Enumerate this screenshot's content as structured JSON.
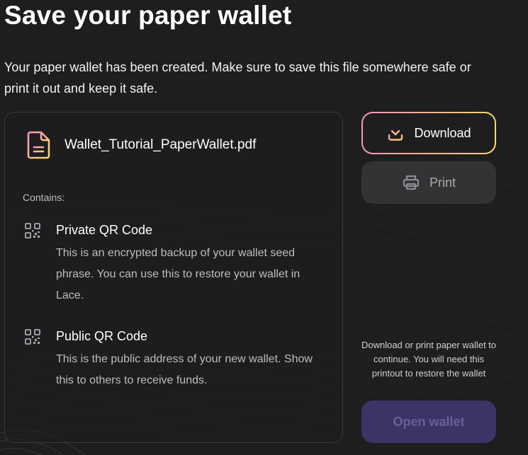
{
  "page": {
    "title": "Save your paper wallet",
    "description": "Your paper wallet has been created. Make sure to save this file somewhere safe or print it out and keep it safe."
  },
  "file": {
    "name": "Wallet_Tutorial_PaperWallet.pdf",
    "icon": "pdf-file-icon",
    "contains_label": "Contains:",
    "items": [
      {
        "icon": "qr-code-icon",
        "title": "Private QR Code",
        "description": "This is an encrypted backup of your wallet seed phrase. You can use this to restore your wallet in Lace."
      },
      {
        "icon": "qr-code-icon",
        "title": "Public QR Code",
        "description": "This is the public address of your new wallet. Show this to others to receive funds."
      }
    ]
  },
  "actions": {
    "download_label": "Download",
    "download_icon": "download-icon",
    "print_label": "Print",
    "print_icon": "printer-icon",
    "helper_text": "Download or print paper wallet to continue. You will need this printout to restore the wallet",
    "open_wallet_label": "Open wallet"
  },
  "colors": {
    "background": "#1e1e1f",
    "gradient": [
      "#ff92c8",
      "#ffb389",
      "#fdd86f"
    ],
    "print_button": "#333335",
    "open_wallet_button": "#3c3367",
    "open_wallet_text": "#695f96"
  }
}
